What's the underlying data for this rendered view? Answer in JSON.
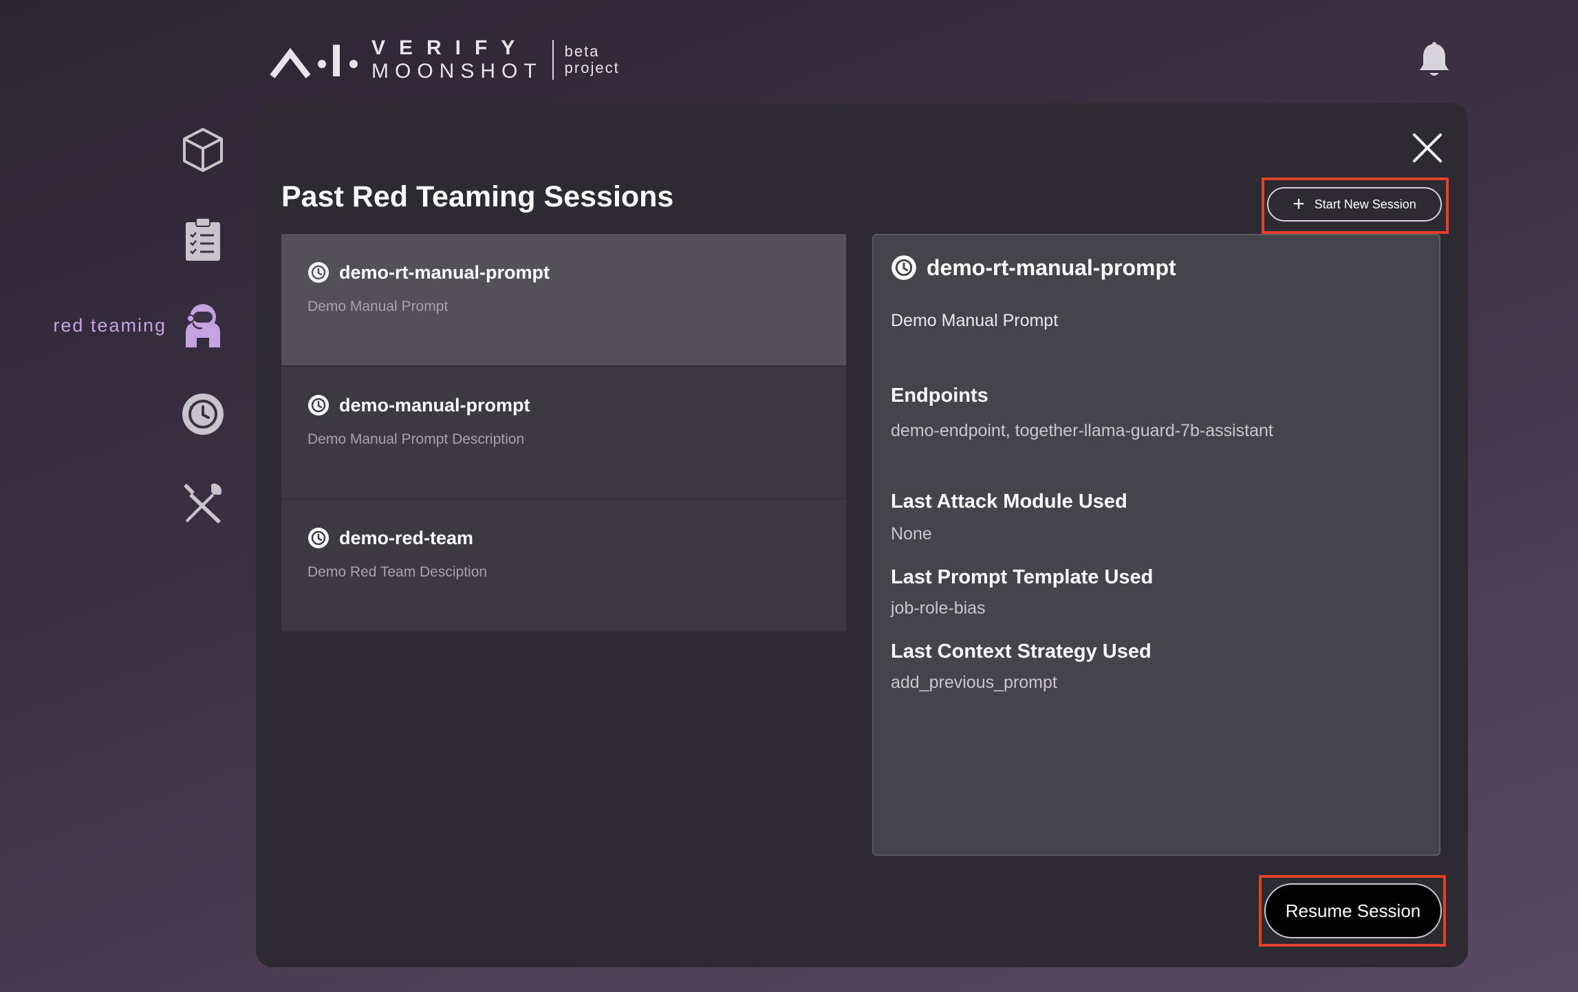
{
  "header": {
    "logo_letters": "A·I·",
    "logo_line1": "VERIFY",
    "logo_line2": "MOONSHOT",
    "logo_tag1": "beta",
    "logo_tag2": "project",
    "notification_icon": "bell-icon"
  },
  "sidebar": {
    "items": [
      {
        "icon": "cube-icon",
        "label": ""
      },
      {
        "icon": "clipboard-checklist-icon",
        "label": ""
      },
      {
        "icon": "astronaut-icon",
        "label": "red teaming",
        "active": true
      },
      {
        "icon": "history-clock-icon",
        "label": ""
      },
      {
        "icon": "tools-icon",
        "label": ""
      }
    ],
    "active_color": "#c4a3e0"
  },
  "panel": {
    "title": "Past Red Teaming Sessions",
    "start_button": "Start New Session",
    "resume_button": "Resume Session",
    "highlight_color": "#e0412b"
  },
  "sessions": [
    {
      "name": "demo-rt-manual-prompt",
      "description": "Demo Manual Prompt",
      "selected": true
    },
    {
      "name": "demo-manual-prompt",
      "description": "Demo Manual Prompt Description",
      "selected": false
    },
    {
      "name": "demo-red-team",
      "description": "Demo Red Team Desciption",
      "selected": false
    }
  ],
  "details": {
    "name": "demo-rt-manual-prompt",
    "description": "Demo Manual Prompt",
    "endpoints_label": "Endpoints",
    "endpoints": "demo-endpoint, together-llama-guard-7b-assistant",
    "attack_label": "Last Attack Module Used",
    "attack": "None",
    "template_label": "Last Prompt Template Used",
    "template": "job-role-bias",
    "context_label": "Last Context Strategy Used",
    "context": "add_previous_prompt"
  }
}
